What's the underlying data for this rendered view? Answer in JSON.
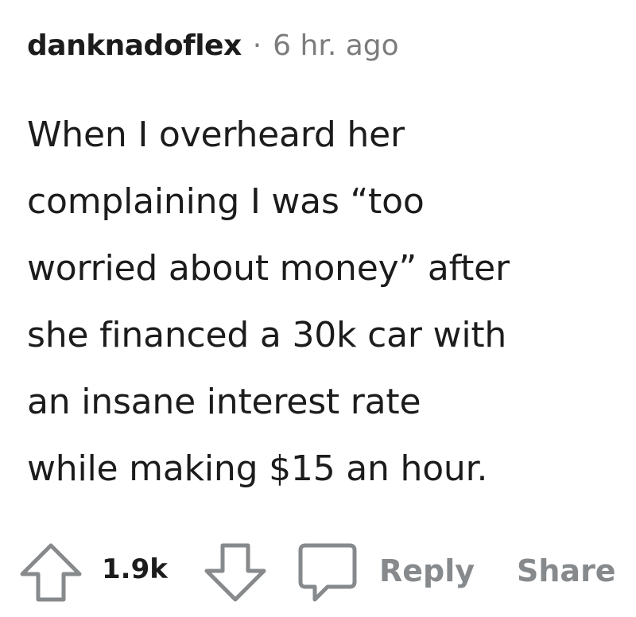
{
  "comment": {
    "author": "danknadoflex",
    "separator": "·",
    "time": "6 hr. ago",
    "body": "When I overheard her\ncomplaining I was “too\nworried about money” after\nshe financed a 30k car with\nan insane interest rate\nwhile making $15 an hour."
  },
  "actions": {
    "score": "1.9k",
    "reply_label": "Reply",
    "share_label": "Share",
    "upvote_icon": "arrow-up-outline",
    "downvote_icon": "arrow-down-outline",
    "comment_icon": "speech-bubble-outline"
  },
  "colors": {
    "text": "#1c1c1c",
    "muted": "#7c7c7c",
    "action_gray": "#878a8c"
  }
}
